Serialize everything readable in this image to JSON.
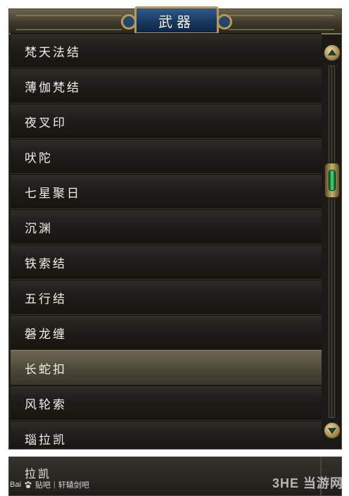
{
  "window": {
    "title": "武器"
  },
  "list": {
    "items": [
      {
        "label": "梵天法结",
        "selected": false
      },
      {
        "label": "薄伽梵结",
        "selected": false
      },
      {
        "label": "夜叉印",
        "selected": false
      },
      {
        "label": "吠陀",
        "selected": false
      },
      {
        "label": "七星聚日",
        "selected": false
      },
      {
        "label": "沉渊",
        "selected": false
      },
      {
        "label": "铁索结",
        "selected": false
      },
      {
        "label": "五行结",
        "selected": false
      },
      {
        "label": "磐龙缠",
        "selected": false
      },
      {
        "label": "长蛇扣",
        "selected": true
      },
      {
        "label": "风轮索",
        "selected": false
      },
      {
        "label": "瑙拉凯",
        "selected": false
      }
    ]
  },
  "scrollbar": {
    "up_icon": "chevron-up-icon",
    "down_icon": "chevron-down-icon",
    "thumb_icon": "green-gem-icon"
  },
  "strip": {
    "label": "拉凯"
  },
  "footer": {
    "left_brand": "Bai",
    "left_brand_icon": "paw-icon",
    "left_site": "贴吧",
    "left_separator": "|",
    "left_forum": "轩辕剑吧",
    "right_watermark": "3HE 当游网"
  },
  "colors": {
    "panel_bg": "#1b1a16",
    "selected_row": "#5a5441",
    "title_plate": "#18385f",
    "gold_trim": "#b89a55",
    "thumb_gem": "#3ee07e"
  }
}
